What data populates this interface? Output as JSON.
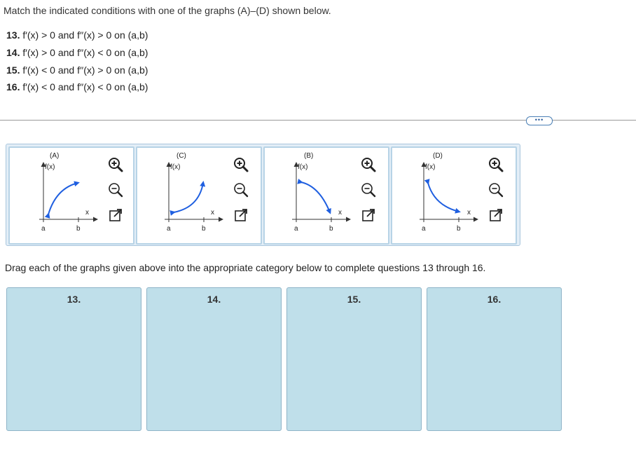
{
  "instructions": "Match the indicated conditions with one of the graphs (A)–(D) shown below.",
  "conditions": [
    {
      "num": "13.",
      "text": " f′(x) > 0 and f′′(x) > 0 on (a,b)"
    },
    {
      "num": "14.",
      "text": " f′(x) > 0 and f′′(x) < 0 on (a,b)"
    },
    {
      "num": "15.",
      "text": " f′(x) < 0 and f′′(x) > 0 on (a,b)"
    },
    {
      "num": "16.",
      "text": " f′(x) < 0 and f′′(x) < 0 on (a,b)"
    }
  ],
  "more_button": "•••",
  "graph_cards": [
    {
      "title": "(A)",
      "ylabel": "f(x)",
      "xlabel": "x",
      "a": "a",
      "b": "b"
    },
    {
      "title": "(C)",
      "ylabel": "f(x)",
      "xlabel": "x",
      "a": "a",
      "b": "b"
    },
    {
      "title": "(B)",
      "ylabel": "f(x)",
      "xlabel": "x",
      "a": "a",
      "b": "b"
    },
    {
      "title": "(D)",
      "ylabel": "f(x)",
      "xlabel": "x",
      "a": "a",
      "b": "b"
    }
  ],
  "card_icons": [
    "zoom-in-icon",
    "zoom-out-icon",
    "pop-out-icon"
  ],
  "drag_instructions": "Drag each of the graphs given above into the appropriate category below to complete questions 13 through 16.",
  "drop_targets": [
    {
      "label": "13."
    },
    {
      "label": "14."
    },
    {
      "label": "15."
    },
    {
      "label": "16."
    }
  ],
  "colors": {
    "curve": "#1f5fe0",
    "tray": "#e3eef7",
    "target": "#bfdfea"
  }
}
